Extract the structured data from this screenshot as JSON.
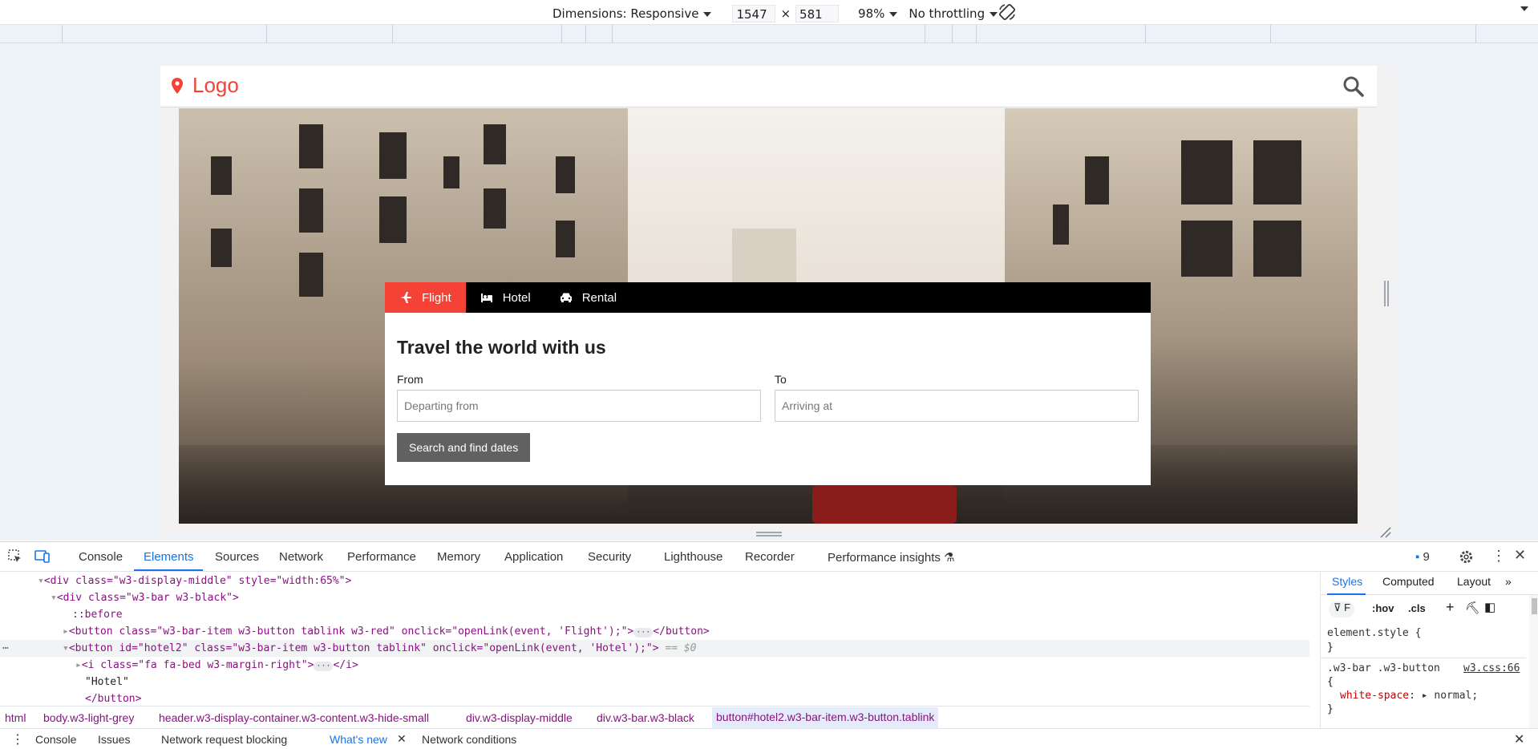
{
  "device_toolbar": {
    "dimensions_label": "Dimensions: Responsive",
    "width": "1547",
    "times": "×",
    "height": "581",
    "zoom": "98%",
    "throttling": "No throttling"
  },
  "site": {
    "logo_text": "Logo",
    "tabs": [
      {
        "label": "Flight",
        "icon": "plane-icon",
        "active": true
      },
      {
        "label": "Hotel",
        "icon": "bed-icon",
        "active": false
      },
      {
        "label": "Rental",
        "icon": "car-icon",
        "active": false
      }
    ],
    "title": "Travel the world with us",
    "from_label": "From",
    "from_placeholder": "Departing from",
    "to_label": "To",
    "to_placeholder": "Arriving at",
    "search_button": "Search and find dates",
    "accent_color": "#f44336"
  },
  "devtools": {
    "tabs": [
      "Console",
      "Elements",
      "Sources",
      "Network",
      "Performance",
      "Memory",
      "Application",
      "Security",
      "Lighthouse",
      "Recorder",
      "Performance insights"
    ],
    "active_tab": "Elements",
    "issues_count": "9",
    "dom_lines": [
      {
        "text_before": "<div class=\"w3-display-middle\" style=\"width:65%\">"
      },
      {
        "text_before": "<div class=\"w3-bar w3-black\">"
      },
      {
        "text_before": "::before"
      },
      {
        "text_before": "<button class=\"w3-bar-item w3-button tablink w3-red\" onclick=\"openLink(event, 'Flight');\">",
        "text_after": "</button>"
      },
      {
        "text_before": "<button id=\"hotel2\" class=\"w3-bar-item w3-button tablink\" onclick=\"openLink(event, 'Hotel');\">",
        "marker": "== $0"
      },
      {
        "text_before": "<i class=\"fa fa-bed w3-margin-right\">",
        "text_after": "</i>"
      },
      {
        "text_before": "\"Hotel\""
      },
      {
        "text_before": "</button>"
      }
    ],
    "breadcrumbs": [
      "html",
      "body.w3-light-grey",
      "header.w3-display-container.w3-content.w3-hide-small",
      "div.w3-display-middle",
      "div.w3-bar.w3-black",
      "button#hotel2.w3-bar-item.w3-button.tablink"
    ],
    "styles_tabs": [
      "Styles",
      "Computed",
      "Layout"
    ],
    "filter_placeholder": "F",
    "hov": ":hov",
    "cls": ".cls",
    "element_style": "element.style {",
    "brace_close": "}",
    "rule_selector": ".w3-bar .w3-button",
    "rule_source": "w3.css:66",
    "rule_open": "{",
    "rule_property": "white-space",
    "rule_value": "normal;",
    "drawer_tabs": [
      "Console",
      "Issues",
      "Network request blocking",
      "What's new",
      "Network conditions"
    ],
    "drawer_active": "What's new"
  }
}
